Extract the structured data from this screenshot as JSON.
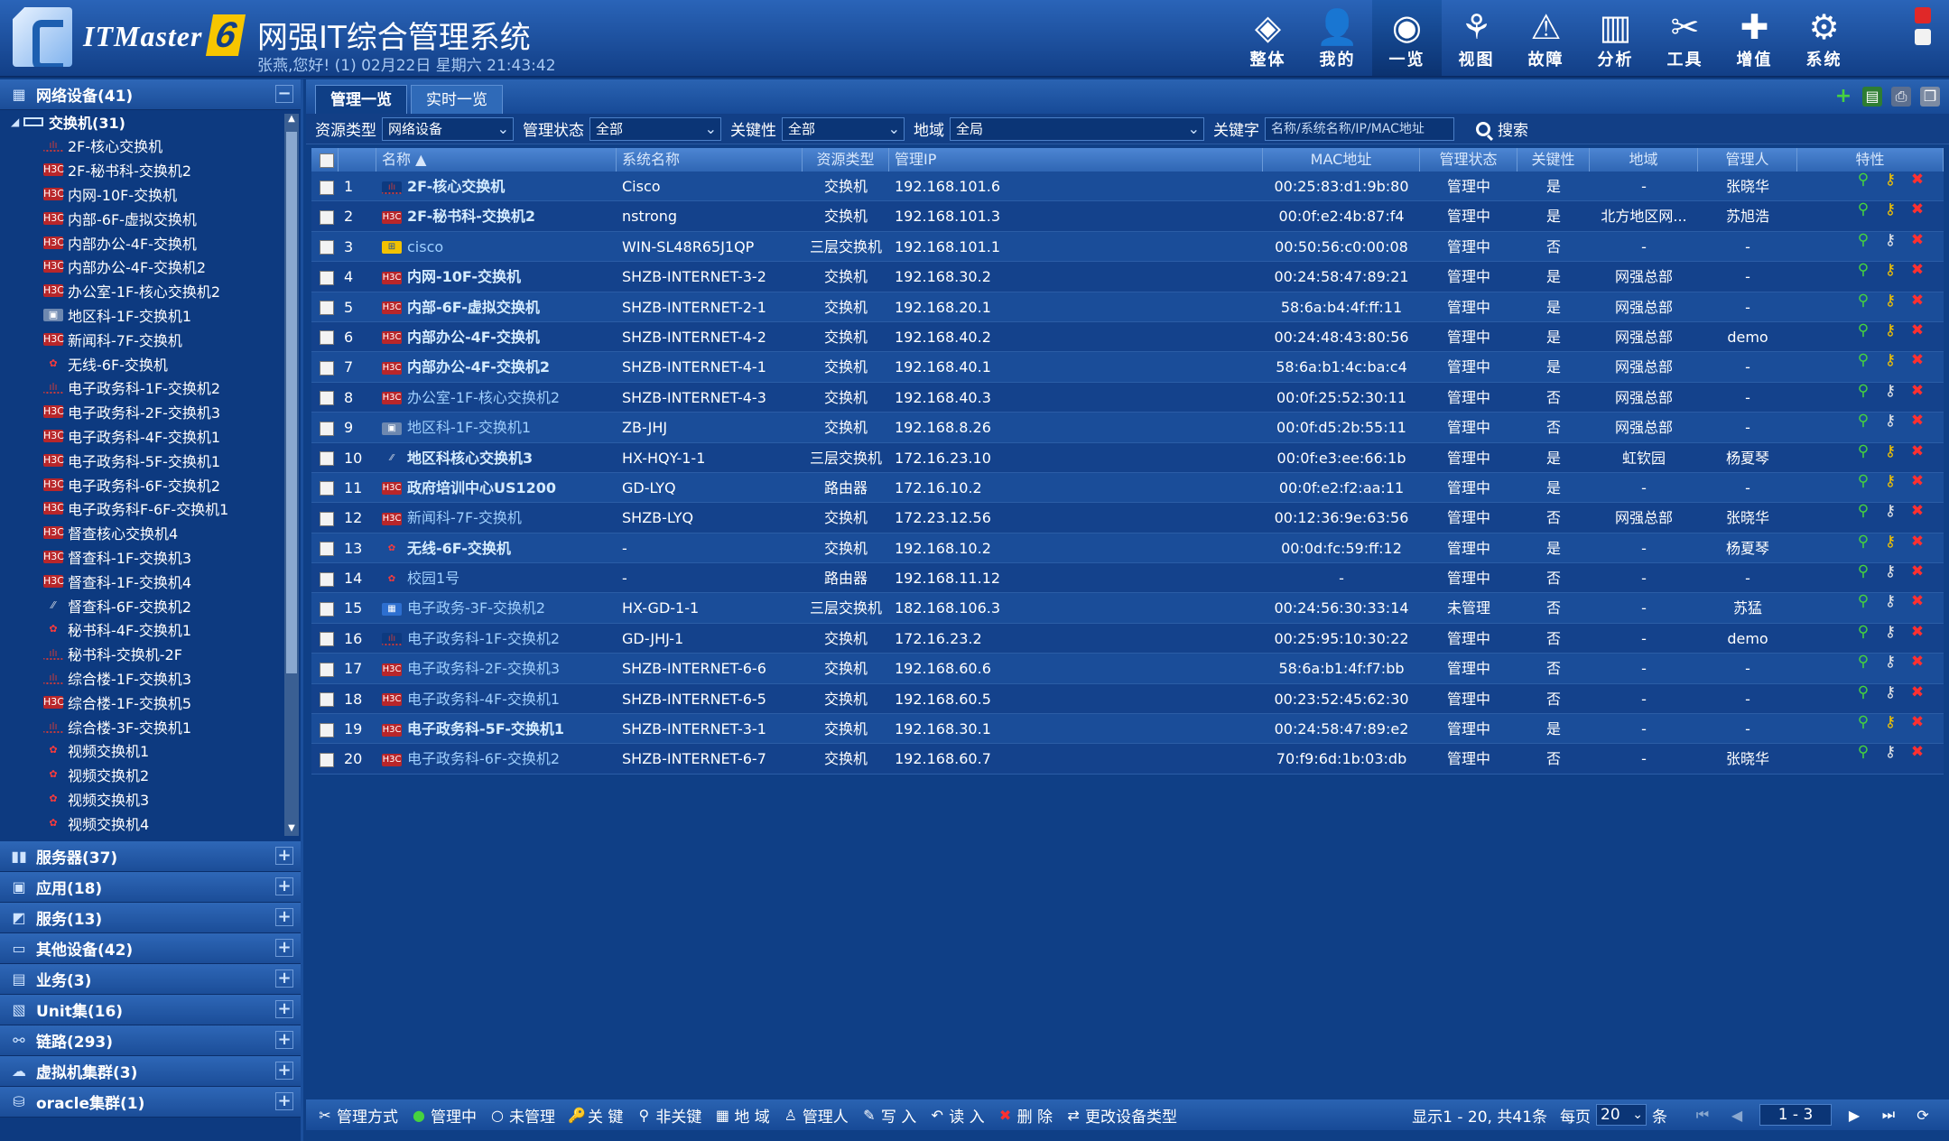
{
  "header": {
    "logo_text": "ITMaster",
    "logo_num": "6",
    "title": "网强IT综合管理系统",
    "user_line": "张燕,您好! (1) 02月22日 星期六 21:43:42",
    "nav": [
      {
        "label": "整体",
        "icon": "layers-icon"
      },
      {
        "label": "我的",
        "icon": "user-icon"
      },
      {
        "label": "一览",
        "icon": "overview-icon",
        "active": true
      },
      {
        "label": "视图",
        "icon": "topology-icon"
      },
      {
        "label": "故障",
        "icon": "warning-icon"
      },
      {
        "label": "分析",
        "icon": "chart-icon"
      },
      {
        "label": "工具",
        "icon": "tools-icon"
      },
      {
        "label": "增值",
        "icon": "plus-icon"
      },
      {
        "label": "系统",
        "icon": "gear-icon"
      }
    ]
  },
  "sidebar": {
    "top_category": "网络设备(41)",
    "sub_group": "交换机(31)",
    "devices": [
      {
        "label": "2F-核心交换机",
        "brand": "cisco"
      },
      {
        "label": "2F-秘书科-交换机2",
        "brand": "h3c"
      },
      {
        "label": "内网-10F-交换机",
        "brand": "h3c"
      },
      {
        "label": "内部-6F-虚拟交换机",
        "brand": "h3c"
      },
      {
        "label": "内部办公-4F-交换机",
        "brand": "h3c"
      },
      {
        "label": "内部办公-4F-交换机2",
        "brand": "h3c"
      },
      {
        "label": "办公室-1F-核心交换机2",
        "brand": "h3c"
      },
      {
        "label": "地区科-1F-交换机1",
        "brand": "generic"
      },
      {
        "label": "新闻科-7F-交换机",
        "brand": "h3c"
      },
      {
        "label": "无线-6F-交换机",
        "brand": "huawei"
      },
      {
        "label": "电子政务科-1F-交换机2",
        "brand": "cisco"
      },
      {
        "label": "电子政务科-2F-交换机3",
        "brand": "h3c"
      },
      {
        "label": "电子政务科-4F-交换机1",
        "brand": "h3c"
      },
      {
        "label": "电子政务科-5F-交换机1",
        "brand": "h3c"
      },
      {
        "label": "电子政务科-6F-交换机2",
        "brand": "h3c"
      },
      {
        "label": "电子政务科F-6F-交换机1",
        "brand": "h3c"
      },
      {
        "label": "督查核心交换机4",
        "brand": "h3c"
      },
      {
        "label": "督查科-1F-交换机3",
        "brand": "h3c"
      },
      {
        "label": "督查科-1F-交换机4",
        "brand": "h3c"
      },
      {
        "label": "督查科-6F-交换机2",
        "brand": "generic2"
      },
      {
        "label": "秘书科-4F-交换机1",
        "brand": "huawei"
      },
      {
        "label": "秘书科-交换机-2F",
        "brand": "cisco"
      },
      {
        "label": "综合楼-1F-交换机3",
        "brand": "cisco"
      },
      {
        "label": "综合楼-1F-交换机5",
        "brand": "h3c"
      },
      {
        "label": "综合楼-3F-交换机1",
        "brand": "cisco"
      },
      {
        "label": "视频交换机1",
        "brand": "huawei"
      },
      {
        "label": "视频交换机2",
        "brand": "huawei"
      },
      {
        "label": "视频交换机3",
        "brand": "huawei"
      },
      {
        "label": "视频交换机4",
        "brand": "huawei"
      }
    ],
    "categories": [
      {
        "label": "服务器(37)",
        "icon": "server-icon"
      },
      {
        "label": "应用(18)",
        "icon": "app-icon"
      },
      {
        "label": "服务(13)",
        "icon": "service-icon"
      },
      {
        "label": "其他设备(42)",
        "icon": "monitor-icon"
      },
      {
        "label": "业务(3)",
        "icon": "business-icon"
      },
      {
        "label": "Unit集(16)",
        "icon": "unit-icon"
      },
      {
        "label": "链路(293)",
        "icon": "link-icon"
      },
      {
        "label": "虚拟机集群(3)",
        "icon": "cloud-icon"
      },
      {
        "label": "oracle集群(1)",
        "icon": "database-icon"
      }
    ]
  },
  "tabs": [
    {
      "label": "管理一览",
      "active": true
    },
    {
      "label": "实时一览",
      "active": false
    }
  ],
  "filters": {
    "res_type_label": "资源类型",
    "res_type_value": "网络设备",
    "mgmt_label": "管理状态",
    "mgmt_value": "全部",
    "key_label": "关键性",
    "key_value": "全部",
    "region_label": "地域",
    "region_value": "全局",
    "keyword_label": "关键字",
    "keyword_placeholder": "名称/系统名称/IP/MAC地址",
    "search_label": "搜索"
  },
  "table": {
    "columns": {
      "name": "名称 ▲",
      "sys": "系统名称",
      "type": "资源类型",
      "ip": "管理IP",
      "mac": "MAC地址",
      "status": "管理状态",
      "key": "关键性",
      "region": "地域",
      "manager": "管理人",
      "attr": "特性"
    },
    "rows": [
      {
        "n": "1",
        "name": "2F-核心交换机",
        "bold": true,
        "brand": "cisco",
        "sys": "Cisco",
        "type": "交换机",
        "ip": "192.168.101.6",
        "mac": "00:25:83:d1:9b:80",
        "status": "管理中",
        "key": "是",
        "region": "-",
        "mgr": "张晓华"
      },
      {
        "n": "2",
        "name": "2F-秘书科-交换机2",
        "bold": true,
        "brand": "h3c",
        "sys": "nstrong",
        "type": "交换机",
        "ip": "192.168.101.3",
        "mac": "00:0f:e2:4b:87:f4",
        "status": "管理中",
        "key": "是",
        "region": "北方地区网...",
        "mgr": "苏旭浩"
      },
      {
        "n": "3",
        "name": "cisco",
        "bold": false,
        "brand": "win",
        "sys": "WIN-SL48R65J1QP",
        "type": "三层交换机",
        "ip": "192.168.101.1",
        "mac": "00:50:56:c0:00:08",
        "status": "管理中",
        "key": "否",
        "region": "-",
        "mgr": "-"
      },
      {
        "n": "4",
        "name": "内网-10F-交换机",
        "bold": true,
        "brand": "h3c",
        "sys": "SHZB-INTERNET-3-2",
        "type": "交换机",
        "ip": "192.168.30.2",
        "mac": "00:24:58:47:89:21",
        "status": "管理中",
        "key": "是",
        "region": "网强总部",
        "mgr": "-"
      },
      {
        "n": "5",
        "name": "内部-6F-虚拟交换机",
        "bold": true,
        "brand": "h3c",
        "sys": "SHZB-INTERNET-2-1",
        "type": "交换机",
        "ip": "192.168.20.1",
        "mac": "58:6a:b4:4f:ff:11",
        "status": "管理中",
        "key": "是",
        "region": "网强总部",
        "mgr": "-"
      },
      {
        "n": "6",
        "name": "内部办公-4F-交换机",
        "bold": true,
        "brand": "h3c",
        "sys": "SHZB-INTERNET-4-2",
        "type": "交换机",
        "ip": "192.168.40.2",
        "mac": "00:24:48:43:80:56",
        "status": "管理中",
        "key": "是",
        "region": "网强总部",
        "mgr": "demo"
      },
      {
        "n": "7",
        "name": "内部办公-4F-交换机2",
        "bold": true,
        "brand": "h3c",
        "sys": "SHZB-INTERNET-4-1",
        "type": "交换机",
        "ip": "192.168.40.1",
        "mac": "58:6a:b1:4c:ba:c4",
        "status": "管理中",
        "key": "是",
        "region": "网强总部",
        "mgr": "-"
      },
      {
        "n": "8",
        "name": "办公室-1F-核心交换机2",
        "bold": false,
        "brand": "h3c",
        "sys": "SHZB-INTERNET-4-3",
        "type": "交换机",
        "ip": "192.168.40.3",
        "mac": "00:0f:25:52:30:11",
        "status": "管理中",
        "key": "否",
        "region": "网强总部",
        "mgr": "-"
      },
      {
        "n": "9",
        "name": "地区科-1F-交换机1",
        "bold": false,
        "brand": "generic",
        "sys": "ZB-JHJ",
        "type": "交换机",
        "ip": "192.168.8.26",
        "mac": "00:0f:d5:2b:55:11",
        "status": "管理中",
        "key": "否",
        "region": "网强总部",
        "mgr": "-"
      },
      {
        "n": "10",
        "name": "地区科核心交换机3",
        "bold": true,
        "brand": "generic2",
        "sys": "HX-HQY-1-1",
        "type": "三层交换机",
        "ip": "172.16.23.10",
        "mac": "00:0f:e3:ee:66:1b",
        "status": "管理中",
        "key": "是",
        "region": "虹钦园",
        "mgr": "杨夏琴"
      },
      {
        "n": "11",
        "name": "政府培训中心US1200",
        "bold": true,
        "brand": "h3c",
        "sys": "GD-LYQ",
        "type": "路由器",
        "ip": "172.16.10.2",
        "mac": "00:0f:e2:f2:aa:11",
        "status": "管理中",
        "key": "是",
        "region": "-",
        "mgr": "-"
      },
      {
        "n": "12",
        "name": "新闻科-7F-交换机",
        "bold": false,
        "brand": "h3c",
        "sys": "SHZB-LYQ",
        "type": "交换机",
        "ip": "172.23.12.56",
        "mac": "00:12:36:9e:63:56",
        "status": "管理中",
        "key": "否",
        "region": "网强总部",
        "mgr": "张晓华"
      },
      {
        "n": "13",
        "name": "无线-6F-交换机",
        "bold": true,
        "brand": "huawei",
        "sys": "-",
        "type": "交换机",
        "ip": "192.168.10.2",
        "mac": "00:0d:fc:59:ff:12",
        "status": "管理中",
        "key": "是",
        "region": "-",
        "mgr": "杨夏琴"
      },
      {
        "n": "14",
        "name": "校园1号",
        "bold": false,
        "brand": "huawei",
        "sys": "-",
        "type": "路由器",
        "ip": "192.168.11.12",
        "mac": "-",
        "status": "管理中",
        "key": "否",
        "region": "-",
        "mgr": "-"
      },
      {
        "n": "15",
        "name": "电子政务-3F-交换机2",
        "bold": false,
        "brand": "blue",
        "sys": "HX-GD-1-1",
        "type": "三层交换机",
        "ip": "182.168.106.3",
        "mac": "00:24:56:30:33:14",
        "status": "未管理",
        "key": "否",
        "region": "-",
        "mgr": "苏猛"
      },
      {
        "n": "16",
        "name": "电子政务科-1F-交换机2",
        "bold": false,
        "brand": "cisco",
        "sys": "GD-JHJ-1",
        "type": "交换机",
        "ip": "172.16.23.2",
        "mac": "00:25:95:10:30:22",
        "status": "管理中",
        "key": "否",
        "region": "-",
        "mgr": "demo"
      },
      {
        "n": "17",
        "name": "电子政务科-2F-交换机3",
        "bold": false,
        "brand": "h3c",
        "sys": "SHZB-INTERNET-6-6",
        "type": "交换机",
        "ip": "192.168.60.6",
        "mac": "58:6a:b1:4f:f7:bb",
        "status": "管理中",
        "key": "否",
        "region": "-",
        "mgr": "-"
      },
      {
        "n": "18",
        "name": "电子政务科-4F-交换机1",
        "bold": false,
        "brand": "h3c",
        "sys": "SHZB-INTERNET-6-5",
        "type": "交换机",
        "ip": "192.168.60.5",
        "mac": "00:23:52:45:62:30",
        "status": "管理中",
        "key": "否",
        "region": "-",
        "mgr": "-"
      },
      {
        "n": "19",
        "name": "电子政务科-5F-交换机1",
        "bold": true,
        "brand": "h3c",
        "sys": "SHZB-INTERNET-3-1",
        "type": "交换机",
        "ip": "192.168.30.1",
        "mac": "00:24:58:47:89:e2",
        "status": "管理中",
        "key": "是",
        "region": "-",
        "mgr": "-"
      },
      {
        "n": "20",
        "name": "电子政务科-6F-交换机2",
        "bold": false,
        "brand": "h3c",
        "sys": "SHZB-INTERNET-6-7",
        "type": "交换机",
        "ip": "192.168.60.7",
        "mac": "70:f9:6d:1b:03:db",
        "status": "管理中",
        "key": "否",
        "region": "-",
        "mgr": "张晓华"
      }
    ]
  },
  "bottom": {
    "buttons": [
      {
        "label": "管理方式",
        "icon": "tools-icon"
      },
      {
        "label": "管理中",
        "icon": "managed-icon"
      },
      {
        "label": "未管理",
        "icon": "unmanaged-icon"
      },
      {
        "label": "关 键",
        "icon": "key-icon"
      },
      {
        "label": "非关键",
        "icon": "key-outline-icon"
      },
      {
        "label": "地 域",
        "icon": "region-icon"
      },
      {
        "label": "管理人",
        "icon": "person-icon"
      },
      {
        "label": "写 入",
        "icon": "write-icon"
      },
      {
        "label": "读 入",
        "icon": "read-icon"
      },
      {
        "label": "删 除",
        "icon": "delete-icon"
      },
      {
        "label": "更改设备类型",
        "icon": "device-type-icon"
      }
    ],
    "display_info": "显示1 - 20, 共41条",
    "per_page_label": "每页",
    "per_page_value": "20",
    "per_page_unit": "条",
    "page_value": "1 - 3"
  }
}
